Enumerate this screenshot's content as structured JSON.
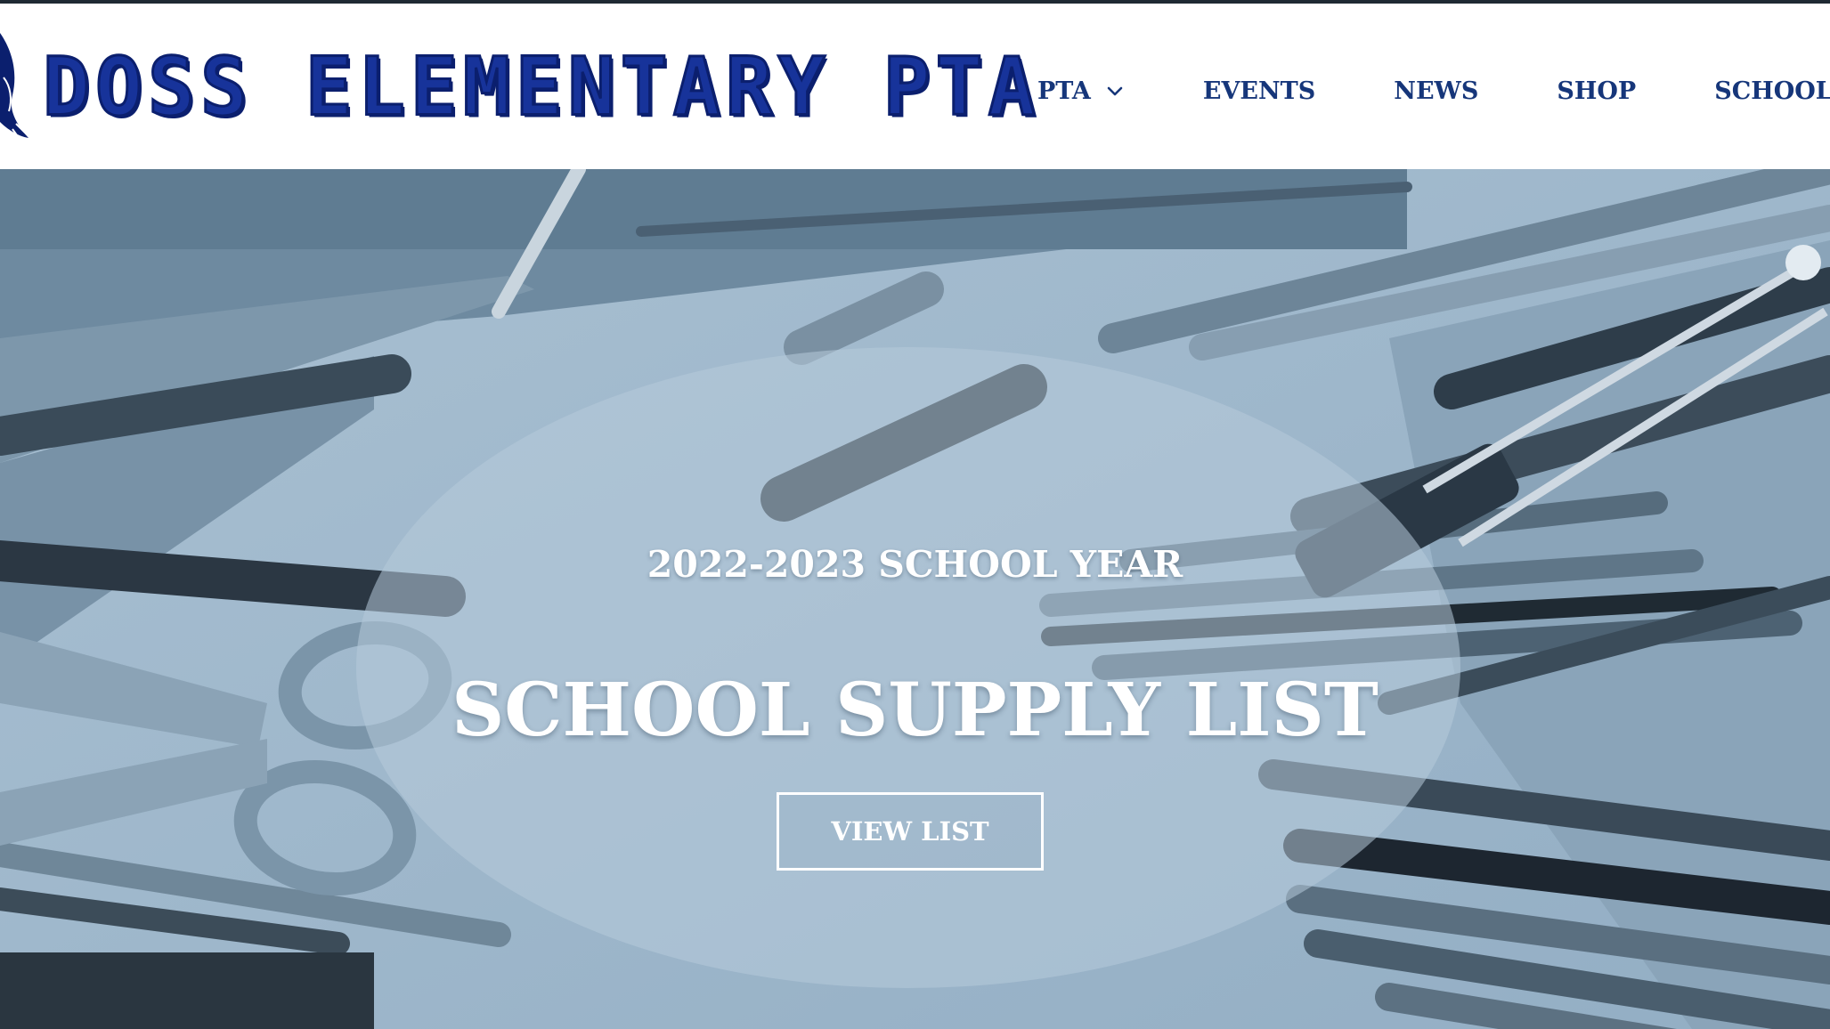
{
  "site": {
    "logo_text": "DOSS ELEMENTARY PTA"
  },
  "nav": {
    "items": [
      {
        "label": "PTA",
        "has_dropdown": true
      },
      {
        "label": "EVENTS",
        "has_dropdown": false
      },
      {
        "label": "NEWS",
        "has_dropdown": false
      },
      {
        "label": "SHOP",
        "has_dropdown": false
      },
      {
        "label": "SCHOOL",
        "has_dropdown": true
      }
    ]
  },
  "hero": {
    "kicker": "2022-2023 SCHOOL YEAR",
    "title": "SCHOOL SUPPLY LIST",
    "button_label": "VIEW LIST"
  },
  "colors": {
    "brand_blue": "#17339a",
    "nav_text": "#16367a",
    "hero_tint": "#9fb6c8",
    "top_rule": "#1f2a33"
  }
}
